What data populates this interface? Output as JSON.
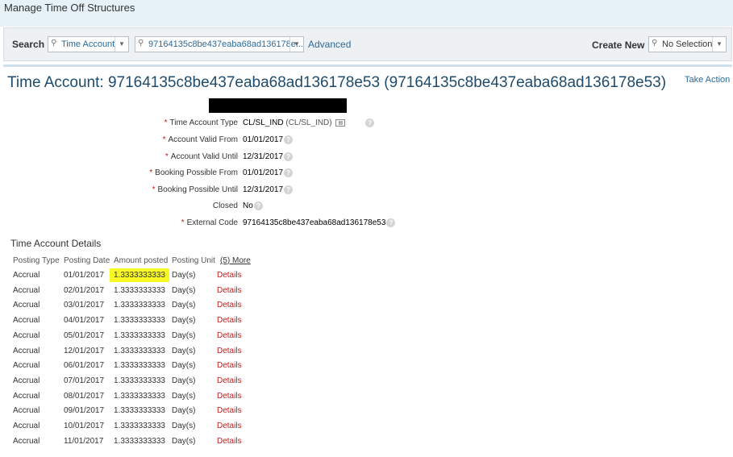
{
  "page_header": "Manage Time Off Structures",
  "search": {
    "label": "Search :",
    "type_value": "Time Account",
    "query_value": "97164135c8be437eaba68ad136178e...",
    "advanced_label": "Advanced",
    "create_label": "Create New :",
    "create_value": "No Selection"
  },
  "account": {
    "title": "Time Account: 97164135c8be437eaba68ad136178e53 (97164135c8be437eaba68ad136178e53)",
    "take_action": "Take Action",
    "fields": [
      {
        "required": "*",
        "label": "Time Account Type",
        "value": "CL/SL_IND",
        "extra": "(CL/SL_IND)"
      },
      {
        "required": "*",
        "label": "Account Valid From",
        "value": "01/01/2017"
      },
      {
        "required": "*",
        "label": "Account Valid Until",
        "value": "12/31/2017"
      },
      {
        "required": "*",
        "label": "Booking Possible From",
        "value": "01/01/2017"
      },
      {
        "required": "*",
        "label": "Booking Possible Until",
        "value": "12/31/2017"
      },
      {
        "required": "",
        "label": "Closed",
        "value": "No"
      },
      {
        "required": "*",
        "label": "External Code",
        "value": "97164135c8be437eaba68ad136178e53"
      }
    ]
  },
  "details": {
    "section_title": "Time Account Details",
    "columns": [
      "Posting Type",
      "Posting Date",
      "Amount posted",
      "Posting Unit",
      "(5) More"
    ],
    "rows": [
      {
        "type": "Accrual",
        "date": "01/01/2017",
        "amount": "1.3333333333",
        "unit": "Day(s)",
        "link": "Details"
      },
      {
        "type": "Accrual",
        "date": "02/01/2017",
        "amount": "1.3333333333",
        "unit": "Day(s)",
        "link": "Details"
      },
      {
        "type": "Accrual",
        "date": "03/01/2017",
        "amount": "1.3333333333",
        "unit": "Day(s)",
        "link": "Details"
      },
      {
        "type": "Accrual",
        "date": "04/01/2017",
        "amount": "1.3333333333",
        "unit": "Day(s)",
        "link": "Details"
      },
      {
        "type": "Accrual",
        "date": "05/01/2017",
        "amount": "1.3333333333",
        "unit": "Day(s)",
        "link": "Details"
      },
      {
        "type": "Accrual",
        "date": "12/01/2017",
        "amount": "1.3333333333",
        "unit": "Day(s)",
        "link": "Details"
      },
      {
        "type": "Accrual",
        "date": "06/01/2017",
        "amount": "1.3333333333",
        "unit": "Day(s)",
        "link": "Details"
      },
      {
        "type": "Accrual",
        "date": "07/01/2017",
        "amount": "1.3333333333",
        "unit": "Day(s)",
        "link": "Details"
      },
      {
        "type": "Accrual",
        "date": "08/01/2017",
        "amount": "1.3333333333",
        "unit": "Day(s)",
        "link": "Details"
      },
      {
        "type": "Accrual",
        "date": "09/01/2017",
        "amount": "1.3333333333",
        "unit": "Day(s)",
        "link": "Details"
      },
      {
        "type": "Accrual",
        "date": "10/01/2017",
        "amount": "1.3333333333",
        "unit": "Day(s)",
        "link": "Details"
      },
      {
        "type": "Accrual",
        "date": "11/01/2017",
        "amount": "1.3333333333",
        "unit": "Day(s)",
        "link": "Details"
      }
    ]
  }
}
